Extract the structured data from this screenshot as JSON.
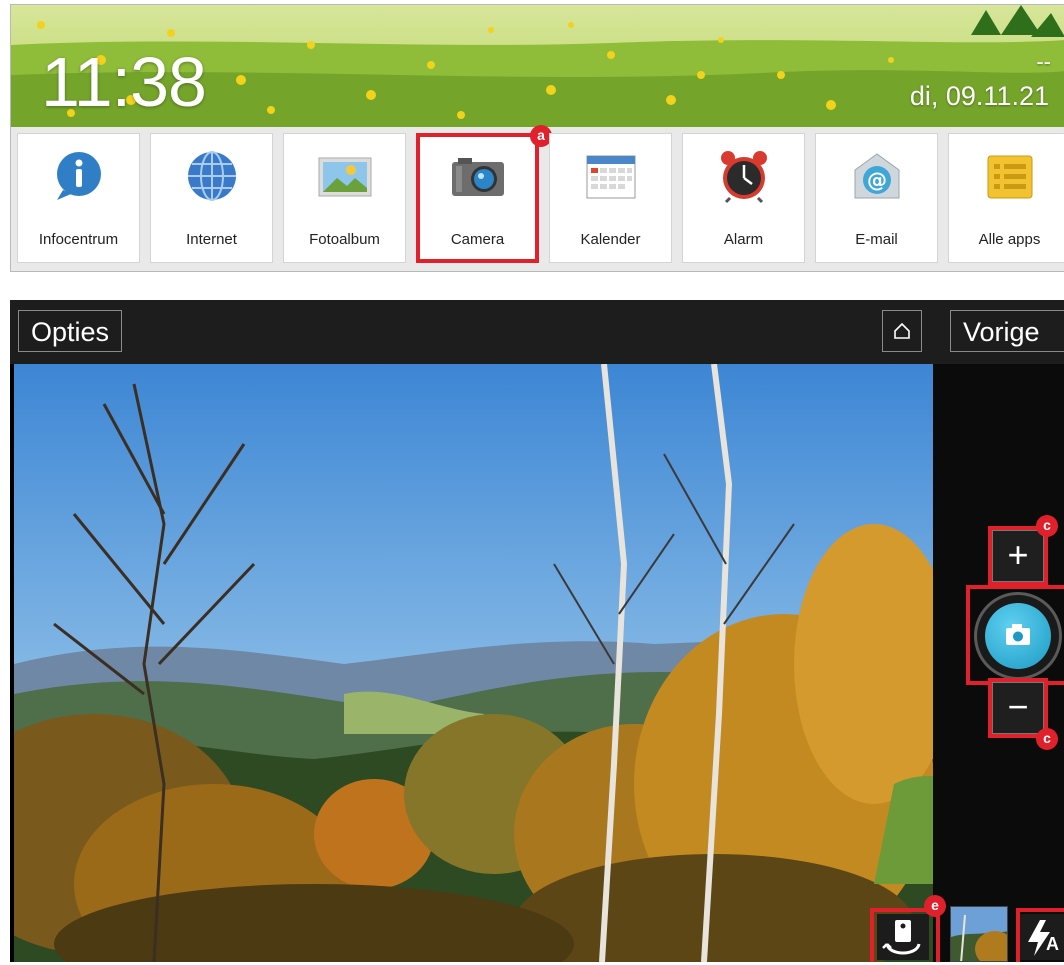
{
  "home": {
    "clock": "11:38",
    "weather": "--",
    "date": "di, 09.11.21",
    "apps": [
      {
        "label": "Infocentrum",
        "icon": "info-bubble-icon"
      },
      {
        "label": "Internet",
        "icon": "globe-icon"
      },
      {
        "label": "Fotoalbum",
        "icon": "photo-album-icon"
      },
      {
        "label": "Camera",
        "icon": "camera-icon",
        "highlighted": true
      },
      {
        "label": "Kalender",
        "icon": "calendar-icon"
      },
      {
        "label": "Alarm",
        "icon": "alarm-clock-icon"
      },
      {
        "label": "E-mail",
        "icon": "email-icon"
      },
      {
        "label": "Alle apps",
        "icon": "all-apps-icon"
      }
    ],
    "markers": {
      "camera": "a"
    }
  },
  "camera": {
    "options_label": "Opties",
    "home_icon": "home-icon",
    "back_label": "Vorige",
    "zoom_in_label": "+",
    "zoom_out_label": "−",
    "markers": {
      "zoom_in": "c",
      "zoom_out": "c",
      "switch_camera": "e"
    },
    "icons": {
      "shutter": "camera-shutter-icon",
      "switch": "switch-camera-icon",
      "flash": "flash-auto-icon",
      "thumbnail": "last-photo-thumbnail"
    },
    "flash_mode": "A"
  },
  "colors": {
    "highlight": "#e0202a",
    "shutter": "#1d9ac4"
  }
}
